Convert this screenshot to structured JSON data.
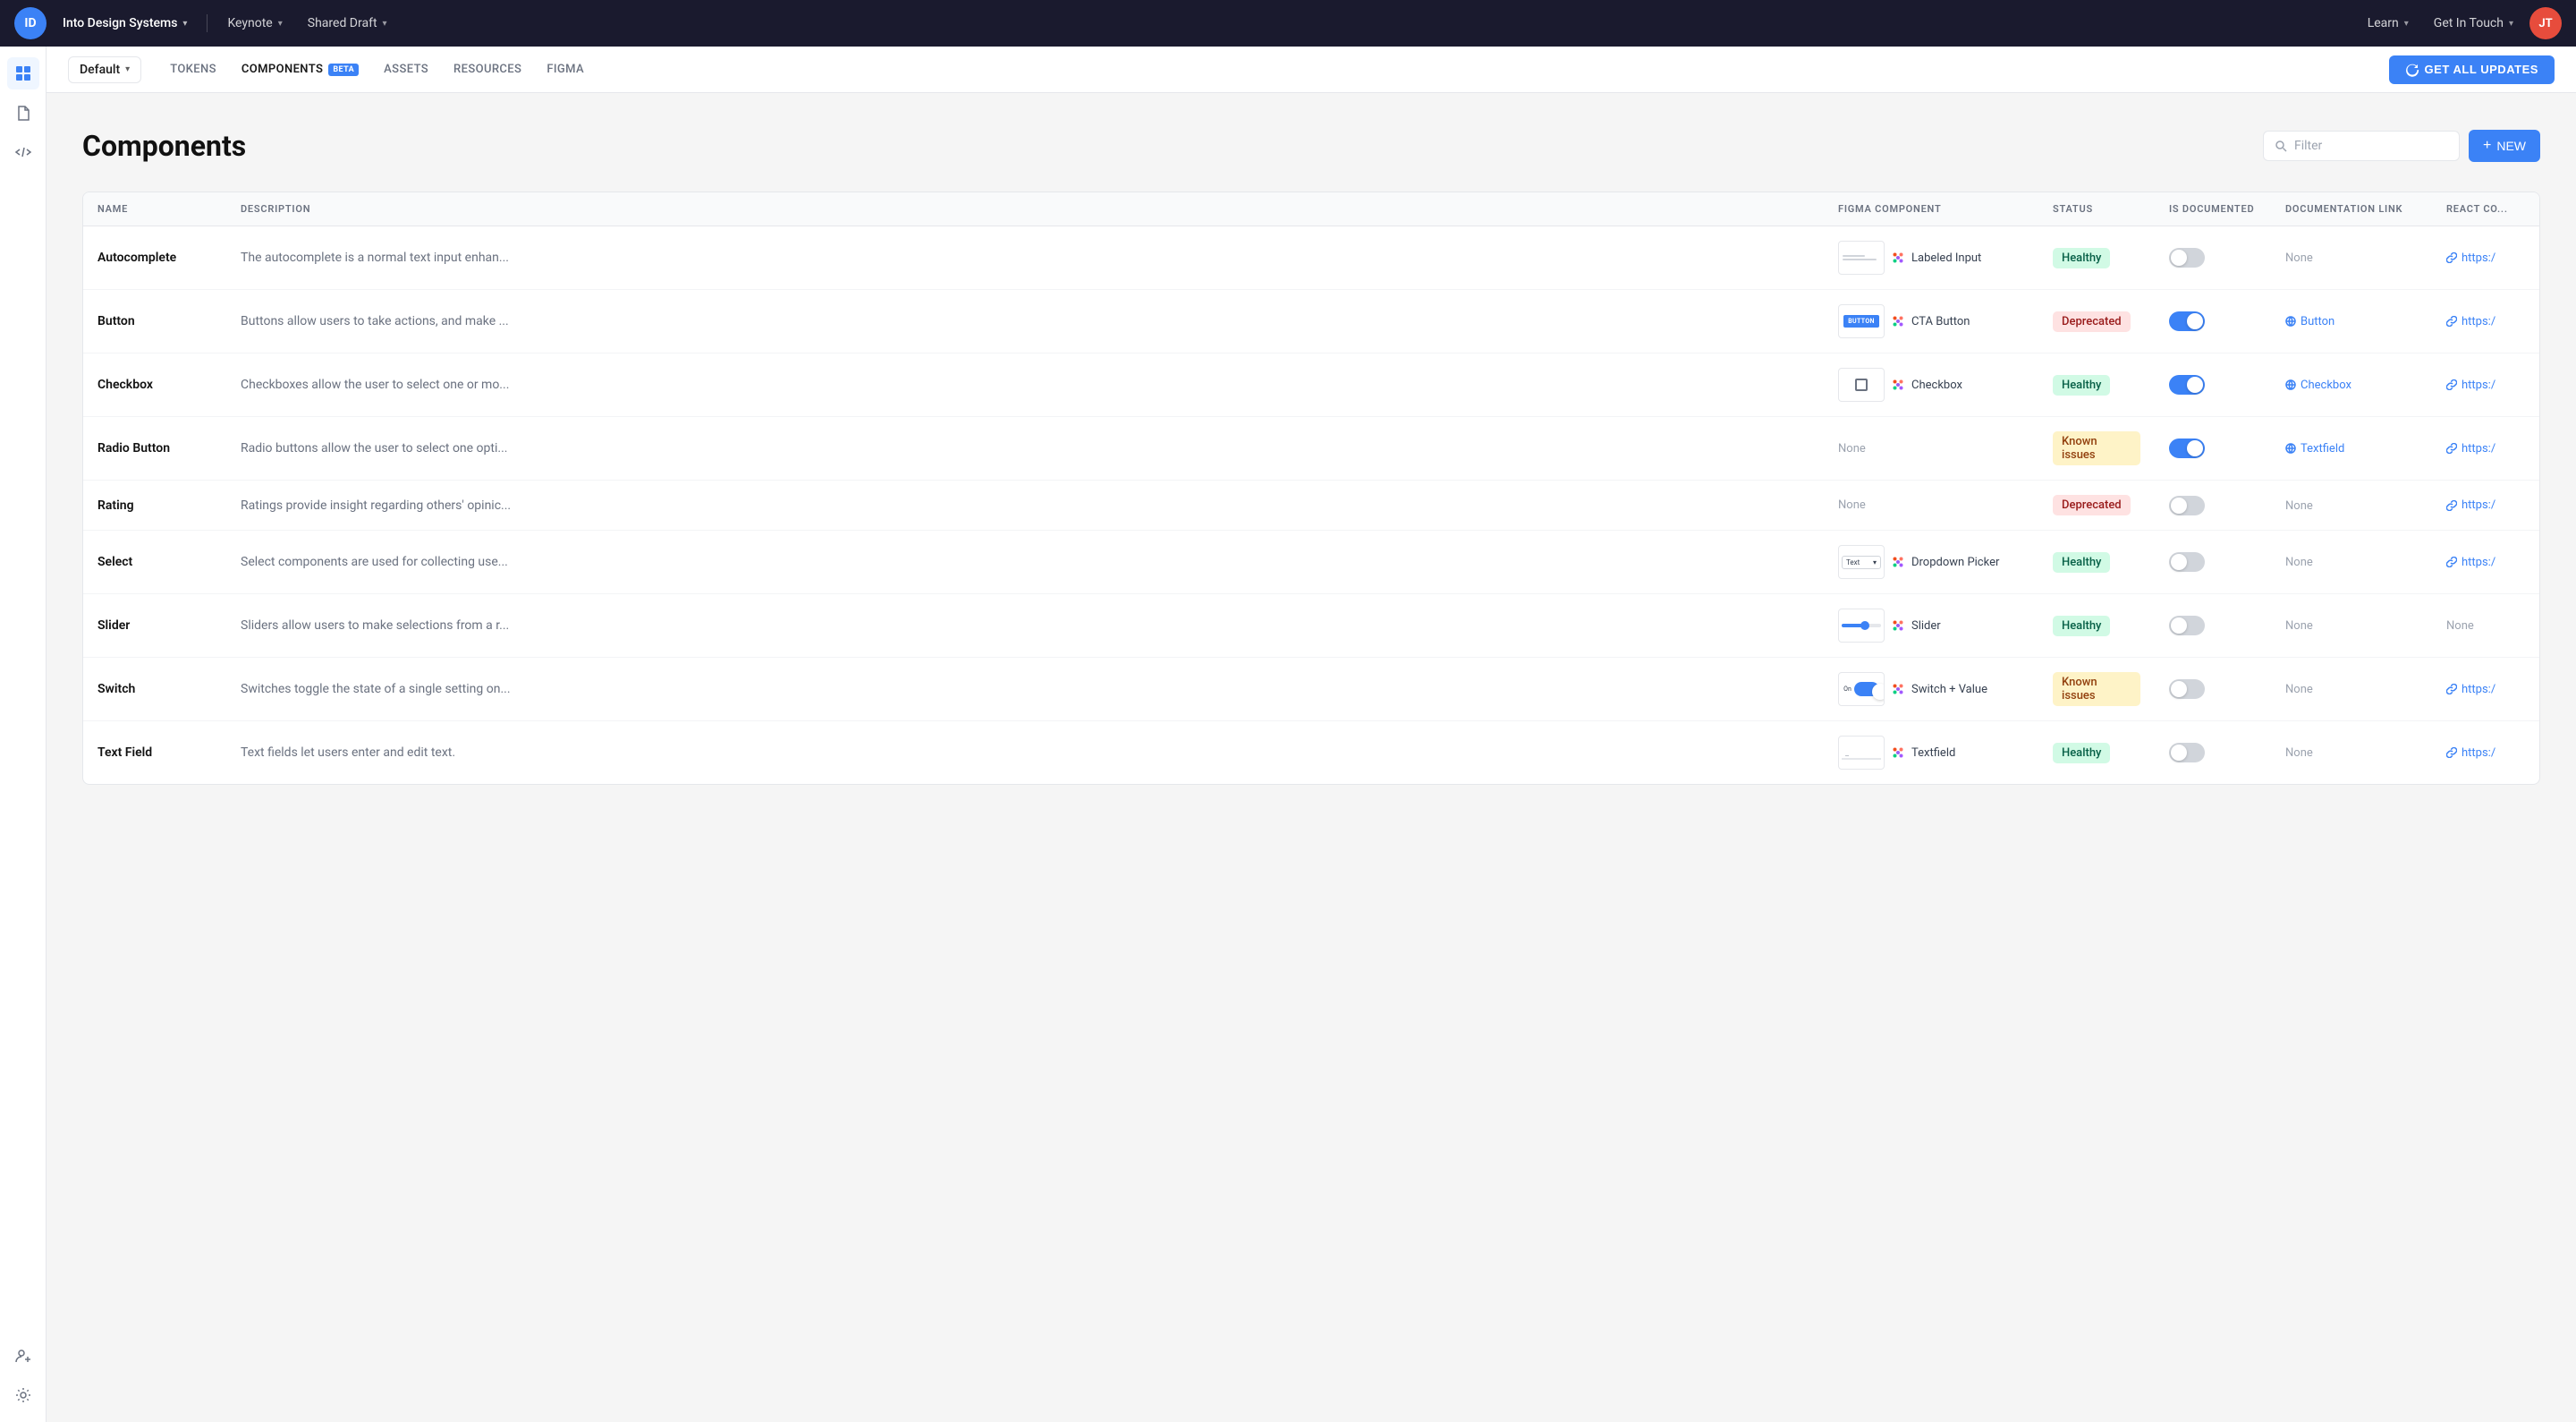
{
  "topNav": {
    "logo_text": "ID",
    "brand_name": "Into Design Systems",
    "nav_items": [
      {
        "label": "Keynote",
        "has_chevron": true
      },
      {
        "label": "Shared Draft",
        "has_chevron": true
      }
    ],
    "right_items": [
      {
        "label": "Learn",
        "has_chevron": true
      },
      {
        "label": "Get In Touch",
        "has_chevron": true
      }
    ],
    "avatar_text": "JT"
  },
  "subNav": {
    "selector_label": "Default",
    "tabs": [
      {
        "label": "TOKENS",
        "active": false
      },
      {
        "label": "COMPONENTS",
        "active": true,
        "badge": "BETA"
      },
      {
        "label": "ASSETS",
        "active": false
      },
      {
        "label": "RESOURCES",
        "active": false
      },
      {
        "label": "FIGMA",
        "active": false
      }
    ],
    "get_updates_label": "GET ALL UPDATES"
  },
  "sidebarIcons": [
    {
      "name": "grid-icon",
      "symbol": "⊞",
      "active": true
    },
    {
      "name": "document-icon",
      "symbol": "📄",
      "active": false
    },
    {
      "name": "code-icon",
      "symbol": "</>",
      "active": false
    },
    {
      "name": "add-user-icon",
      "symbol": "👤",
      "active": false,
      "bottom": true
    },
    {
      "name": "settings-icon",
      "symbol": "⚙",
      "active": false,
      "bottom": true
    }
  ],
  "page": {
    "title": "Components",
    "filter_placeholder": "Filter",
    "new_button_label": "NEW"
  },
  "table": {
    "columns": [
      {
        "key": "name",
        "label": "NAME"
      },
      {
        "key": "description",
        "label": "DESCRIPTION"
      },
      {
        "key": "figma_component",
        "label": "FIGMA COMPONENT"
      },
      {
        "key": "status",
        "label": "STATUS"
      },
      {
        "key": "is_documented",
        "label": "IS DOCUMENTED"
      },
      {
        "key": "documentation_link",
        "label": "DOCUMENTATION LINK"
      },
      {
        "key": "react_component",
        "label": "REACT CO..."
      }
    ],
    "rows": [
      {
        "name": "Autocomplete",
        "description": "The autocomplete is a normal text input enhan...",
        "preview_type": "labeled_input",
        "figma_name": "Labeled Input",
        "status": "Healthy",
        "status_type": "healthy",
        "is_documented": false,
        "doc_link": "None",
        "doc_link_type": "none",
        "react_url": "https:/",
        "react_type": "link"
      },
      {
        "name": "Button",
        "description": "Buttons allow users to take actions, and make ...",
        "preview_type": "button",
        "figma_name": "CTA Button",
        "status": "Deprecated",
        "status_type": "deprecated",
        "is_documented": true,
        "doc_link": "Button",
        "doc_link_type": "link",
        "react_url": "https:/",
        "react_type": "link"
      },
      {
        "name": "Checkbox",
        "description": "Checkboxes allow the user to select one or mo...",
        "preview_type": "checkbox",
        "figma_name": "Checkbox",
        "status": "Healthy",
        "status_type": "healthy",
        "is_documented": true,
        "doc_link": "Checkbox",
        "doc_link_type": "link",
        "react_url": "https:/",
        "react_type": "link"
      },
      {
        "name": "Radio Button",
        "description": "Radio buttons allow the user to select one opti...",
        "preview_type": "none",
        "figma_name": "",
        "status": "Known issues",
        "status_type": "known",
        "is_documented": true,
        "doc_link": "Textfield",
        "doc_link_type": "link",
        "react_url": "https:/",
        "react_type": "link"
      },
      {
        "name": "Rating",
        "description": "Ratings provide insight regarding others' opinic...",
        "preview_type": "none",
        "figma_name": "",
        "status": "Deprecated",
        "status_type": "deprecated",
        "is_documented": false,
        "doc_link": "None",
        "doc_link_type": "none",
        "react_url": "https:/",
        "react_type": "link"
      },
      {
        "name": "Select",
        "description": "Select components are used for collecting use...",
        "preview_type": "select",
        "figma_name": "Dropdown Picker",
        "status": "Healthy",
        "status_type": "healthy",
        "is_documented": false,
        "doc_link": "None",
        "doc_link_type": "none",
        "react_url": "https:/",
        "react_type": "link"
      },
      {
        "name": "Slider",
        "description": "Sliders allow users to make selections from a r...",
        "preview_type": "slider",
        "figma_name": "Slider",
        "status": "Healthy",
        "status_type": "healthy",
        "is_documented": false,
        "doc_link": "None",
        "doc_link_type": "none",
        "react_url": "None",
        "react_type": "none"
      },
      {
        "name": "Switch",
        "description": "Switches toggle the state of a single setting on...",
        "preview_type": "switch",
        "figma_name": "Switch + Value",
        "status": "Known issues",
        "status_type": "known",
        "is_documented": false,
        "doc_link": "None",
        "doc_link_type": "none",
        "react_url": "https:/",
        "react_type": "link"
      },
      {
        "name": "Text Field",
        "description": "Text fields let users enter and edit text.",
        "preview_type": "textfield",
        "figma_name": "Textfield",
        "status": "Healthy",
        "status_type": "healthy",
        "is_documented": false,
        "doc_link": "None",
        "doc_link_type": "none",
        "react_url": "https:/",
        "react_type": "link"
      }
    ]
  }
}
